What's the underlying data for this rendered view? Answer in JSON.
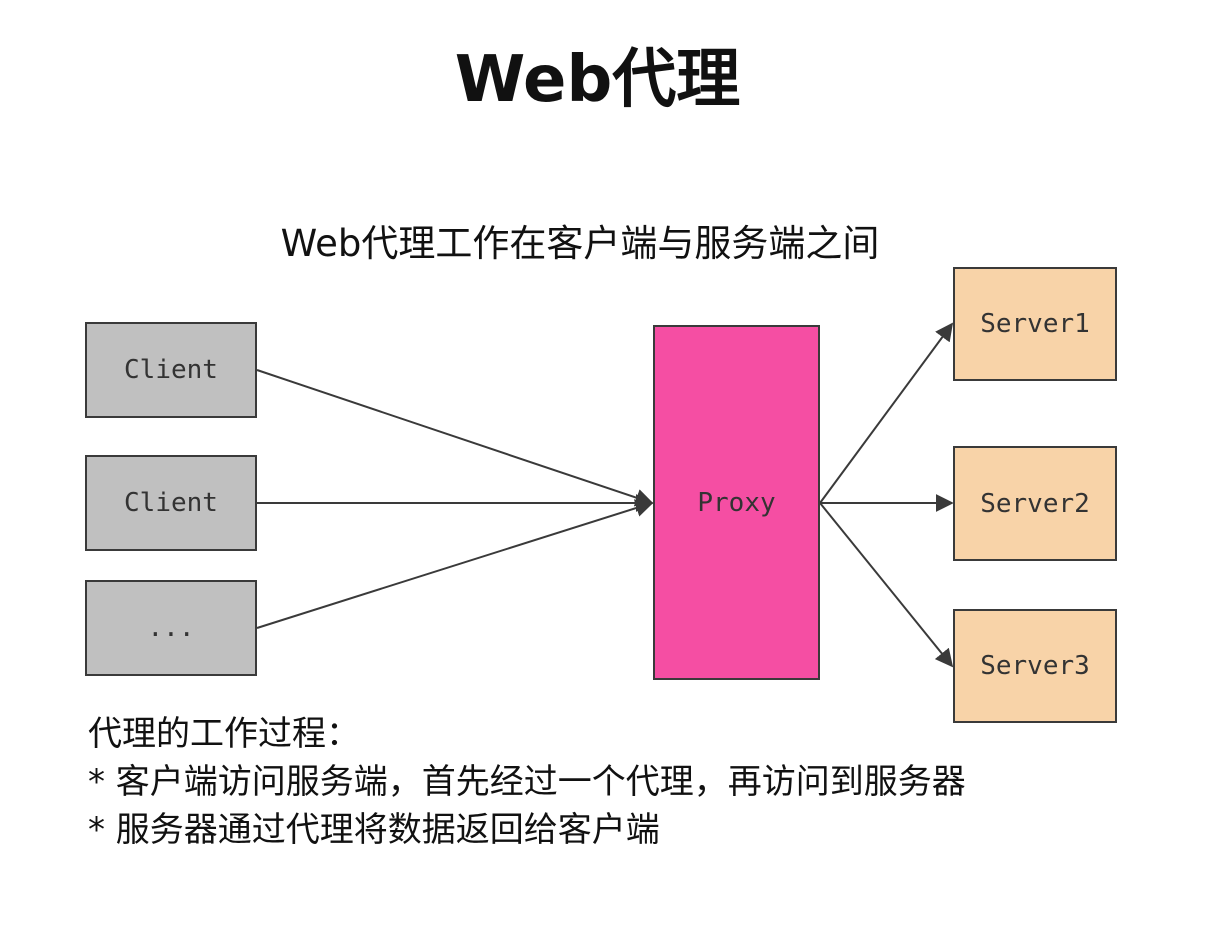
{
  "title": "Web代理",
  "subtitle": "Web代理工作在客户端与服务端之间",
  "diagram": {
    "clients": [
      {
        "label": "Client"
      },
      {
        "label": "Client"
      },
      {
        "label": "..."
      }
    ],
    "proxy": {
      "label": "Proxy"
    },
    "servers": [
      {
        "label": "Server1"
      },
      {
        "label": "Server2"
      },
      {
        "label": "Server3"
      }
    ],
    "colors": {
      "client_fill": "#c0c0c0",
      "proxy_fill": "#f54ea3",
      "server_fill": "#f8d3a8",
      "stroke": "#3a3a3a"
    }
  },
  "notes": {
    "heading": "代理的工作过程：",
    "items": [
      "* 客户端访问服务端，首先经过一个代理，再访问到服务器",
      "* 服务器通过代理将数据返回给客户端"
    ]
  }
}
